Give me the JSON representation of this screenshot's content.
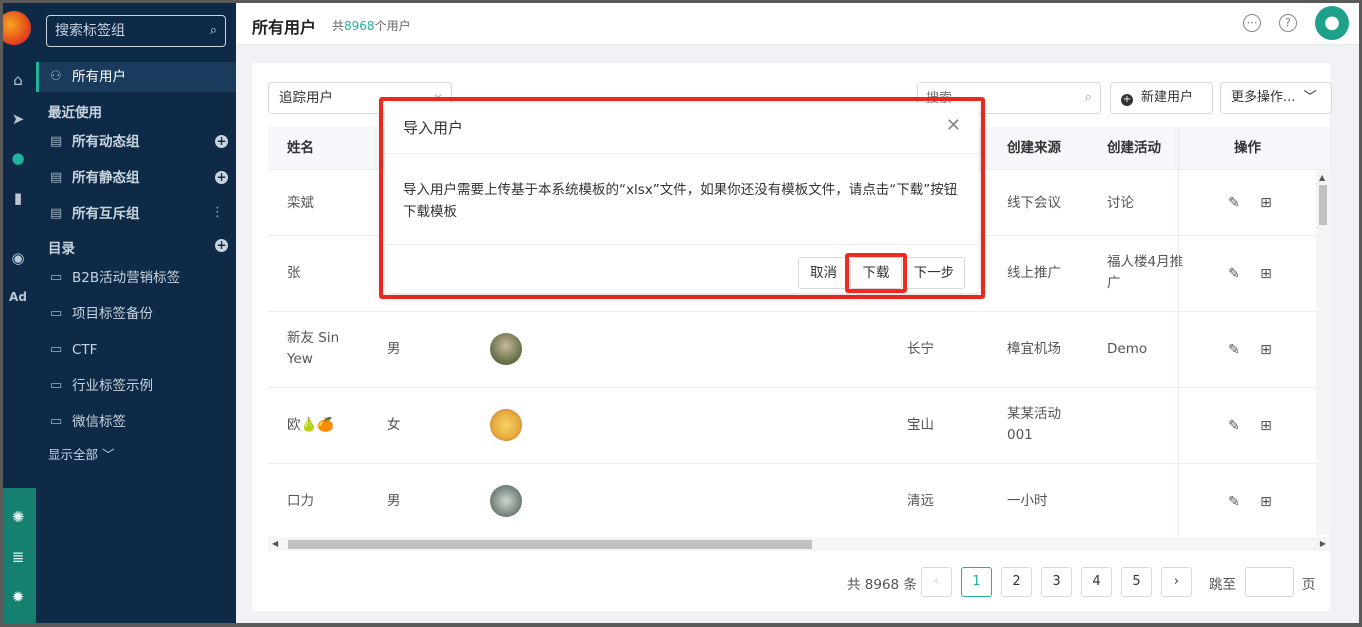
{
  "rail": {
    "icons": [
      "home-icon",
      "send-icon",
      "user-icon",
      "chart-icon",
      "wechat-icon",
      "ad-icon",
      "hub-icon",
      "server-icon",
      "gear-icon"
    ]
  },
  "sidebar": {
    "search_placeholder": "搜索标签组",
    "active_item": "所有用户",
    "recent_label": "最近使用",
    "recent_items": [
      "所有动态组",
      "所有静态组",
      "所有互斥组"
    ],
    "catalog_label": "目录",
    "folders": [
      "B2B活动营销标签",
      "项目标签备份",
      "CTF",
      "行业标签示例",
      "微信标签"
    ],
    "show_all": "显示全部"
  },
  "header": {
    "title": "所有用户",
    "count_prefix": "共",
    "count_value": "8968",
    "count_suffix": "个用户"
  },
  "toolbar": {
    "filter_value": "追踪用户",
    "search_placeholder": "搜索",
    "new_user": "新建用户",
    "more_actions": "更多操作..."
  },
  "table": {
    "columns": {
      "name": "姓名",
      "source": "创建来源",
      "activity": "创建活动",
      "actions": "操作"
    },
    "rows": [
      {
        "name": "栾斌",
        "gender": "",
        "city": "",
        "source": "线下会议",
        "activity": "讨论"
      },
      {
        "name": "张",
        "gender": "",
        "city": "",
        "source": "线上推广",
        "activity": "福人楼4月推广"
      },
      {
        "name": "新友 Sin Yew",
        "gender": "男",
        "city": "长宁",
        "source": "樟宜机场",
        "activity": "Demo"
      },
      {
        "name": "欧🍐🍊",
        "gender": "女",
        "city": "宝山",
        "source": "某某活动001",
        "activity": ""
      },
      {
        "name": "口力",
        "gender": "男",
        "city": "清远",
        "source": "一小时",
        "activity": ""
      }
    ]
  },
  "pagination": {
    "total": "共 8968 条",
    "pages": [
      "1",
      "2",
      "3",
      "4",
      "5"
    ],
    "current": "1",
    "jump_label": "跳至",
    "page_label": "页"
  },
  "modal": {
    "title": "导入用户",
    "body": "导入用户需要上传基于本系统模板的“xlsx”文件，如果你还没有模板文件，请点击“下载”按钮下载模板",
    "cancel": "取消",
    "download": "下载",
    "next": "下一步"
  },
  "colors": {
    "accent": "#1fb39a",
    "sidebar": "#0e2a47",
    "highlight": "#f02a20"
  }
}
